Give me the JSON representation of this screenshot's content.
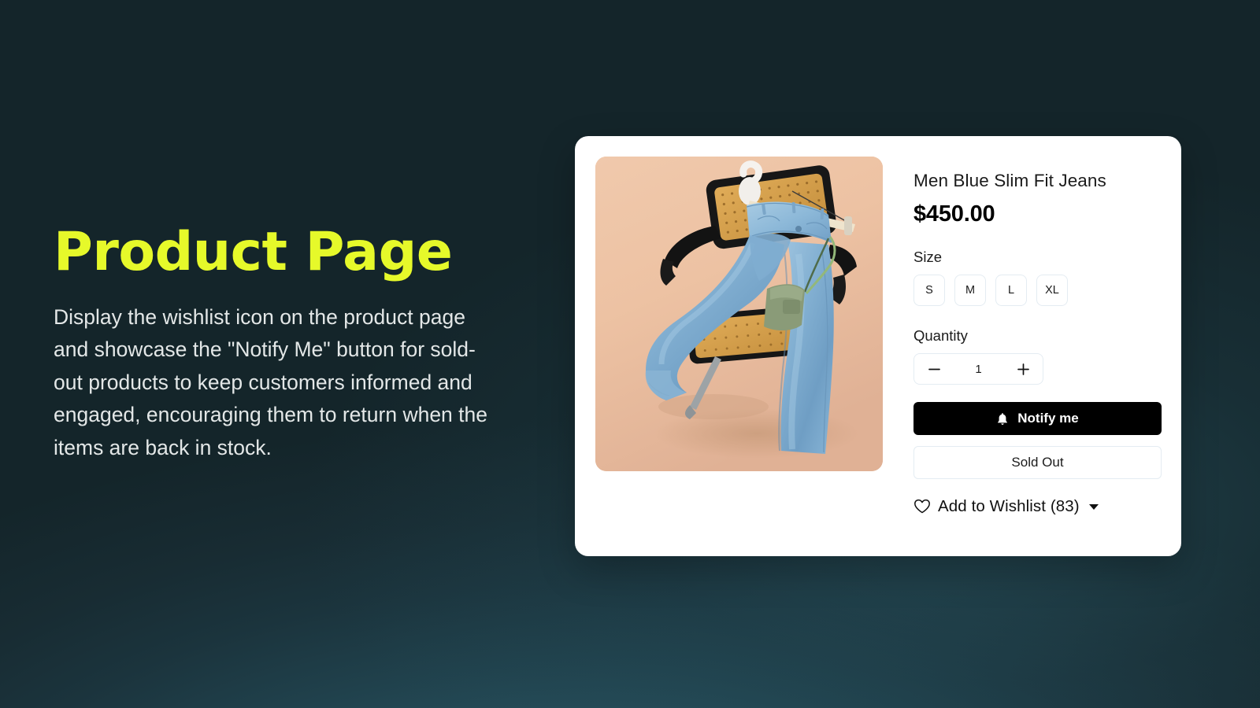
{
  "theme": {
    "background_dark": "#16272b",
    "background_teal_glow": "#34697a",
    "headline_color": "#e6f92a",
    "body_text_color": "#e3e7e7",
    "card_background": "#ffffff",
    "primary_button_color": "#000000",
    "border_color": "#e4ecf2",
    "product_image_background": "#edc3a4"
  },
  "left_panel": {
    "headline": "Product Page",
    "description": "Display the wishlist icon on the product page and showcase the \"Notify Me\" button for sold-out products to keep customers informed and engaged, encouraging them to return when the items are back in stock."
  },
  "product_card": {
    "image": {
      "alt": "Men Blue Slim Fit Jeans draped over a black rattan chair",
      "icon": "product-photo"
    },
    "title": "Men Blue Slim Fit Jeans",
    "price": "$450.00",
    "size": {
      "label": "Size",
      "options": [
        "S",
        "M",
        "L",
        "XL"
      ]
    },
    "quantity": {
      "label": "Quantity",
      "value": "1",
      "decrease_icon": "minus-icon",
      "increase_icon": "plus-icon"
    },
    "notify_button": {
      "label": "Notify me",
      "icon": "bell-icon"
    },
    "sold_out_button": {
      "label": "Sold Out"
    },
    "wishlist": {
      "label": "Add to Wishlist (83)",
      "count": "83",
      "heart_icon": "heart-outline-icon",
      "caret_icon": "chevron-down-icon"
    }
  }
}
